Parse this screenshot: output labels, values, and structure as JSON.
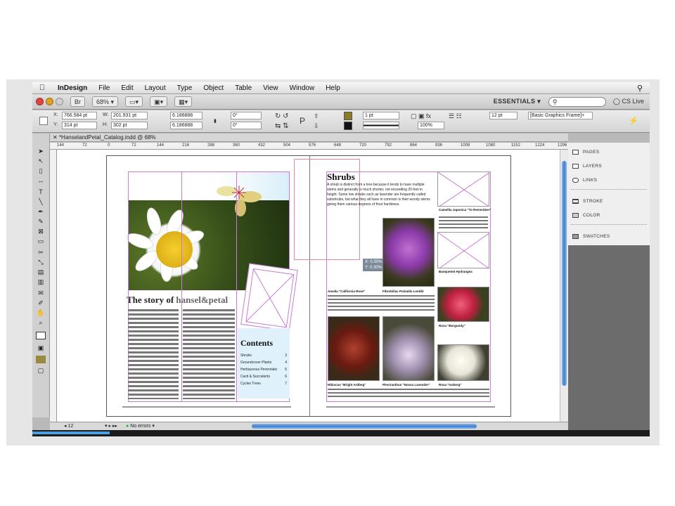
{
  "menubar": {
    "app_name": "InDesign",
    "items": [
      "File",
      "Edit",
      "Layout",
      "Type",
      "Object",
      "Table",
      "View",
      "Window",
      "Help"
    ]
  },
  "appbar": {
    "zoom": "68%",
    "workspace": "ESSENTIALS ▾",
    "cs_live": "CS Live"
  },
  "control": {
    "x": "766.584 pt",
    "y": "314 pt",
    "w": "201.931 pt",
    "h": "302 pt",
    "scale_x": "6.186888",
    "scale_y": "6.186888",
    "rotate": "0°",
    "shear": "0°",
    "stroke_weight": "1 pt",
    "opacity": "100%",
    "spacing": "12 pt",
    "object_style": "[Basic Graphics Frame]+"
  },
  "document": {
    "tab_title": "*HanselandPetal_Catalog.indd @ 68%",
    "ruler_ticks": [
      "144",
      "72",
      "0",
      "72",
      "144",
      "216",
      "288",
      "360",
      "432",
      "504",
      "576",
      "648",
      "720",
      "792",
      "864",
      "936",
      "1008",
      "1080",
      "1152",
      "1224",
      "1296"
    ]
  },
  "status": {
    "page": "12",
    "errors": "No errors"
  },
  "panels": [
    {
      "label": "PAGES"
    },
    {
      "label": "LAYERS"
    },
    {
      "label": "LINKS"
    },
    {
      "label": "STROKE"
    },
    {
      "label": "COLOR"
    },
    {
      "label": "SWATCHES"
    }
  ],
  "left_page": {
    "story_title": "The story of ",
    "brand": "hansel&petal",
    "contents_title": "Contents",
    "toc": [
      {
        "label": "Shrubs",
        "page": "3"
      },
      {
        "label": "Groundcover Plants",
        "page": "4"
      },
      {
        "label": "Herbaceous Perennials",
        "page": "5"
      },
      {
        "label": "Cacti & Succulents",
        "page": "6"
      },
      {
        "label": "Cycles Trees",
        "page": "7"
      }
    ]
  },
  "right_page": {
    "heading": "Shrubs",
    "intro": "A shrub is distinct from a tree because it tends to have multiple stems and generally is much shorter, not exceeding 20 feet in height. Some low shrubs such as lavender are frequently called subshrubs, but what they all have in common is their woody stems giving them various degrees of frost hardiness.",
    "coords": {
      "x": "X: 0.30%",
      "y": "Y: 0.30%"
    },
    "captions": [
      "Camellia Japonica \"To Remember\"",
      "Banqueted Hydrangea",
      "Rosa \"Burgundy\"",
      "Rosa \"Iceberg\"",
      "Fibrobiliac Pulsatila Lentibl",
      "Amelia \"California Rose\"",
      "Hibiscus \"Bright Ardbeg\"",
      "Plectranthus \"Nossa Lavender\""
    ]
  }
}
